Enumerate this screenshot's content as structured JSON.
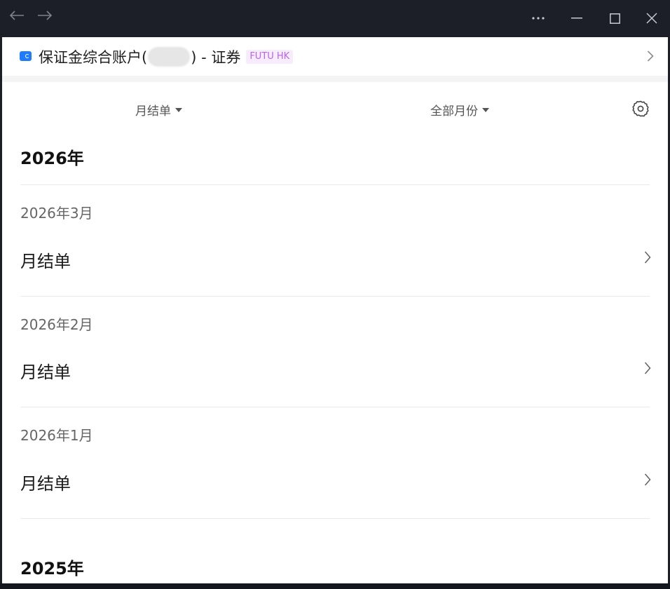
{
  "titlebar": {
    "back_icon": "arrow-left-icon",
    "forward_icon": "arrow-right-icon",
    "more_icon": "ellipsis-icon",
    "minimize_icon": "minimize-icon",
    "maximize_icon": "maximize-icon",
    "close_icon": "close-icon"
  },
  "account": {
    "name_prefix": "保证金综合账户(",
    "name_suffix": ") - 证券",
    "broker_tag": "FUTU HK",
    "icon": "wallet-icon",
    "accent_color": "#1f7cff",
    "tag_color": "#b866e6"
  },
  "filters": {
    "statement_type": "月结单",
    "month_range": "全部月份",
    "settings_icon": "gear-icon"
  },
  "years": [
    {
      "label": "2026年",
      "months": [
        {
          "label": "2026年3月",
          "statement": "月结单"
        },
        {
          "label": "2026年2月",
          "statement": "月结单"
        },
        {
          "label": "2026年1月",
          "statement": "月结单"
        }
      ]
    },
    {
      "label": "2025年",
      "months": []
    }
  ]
}
